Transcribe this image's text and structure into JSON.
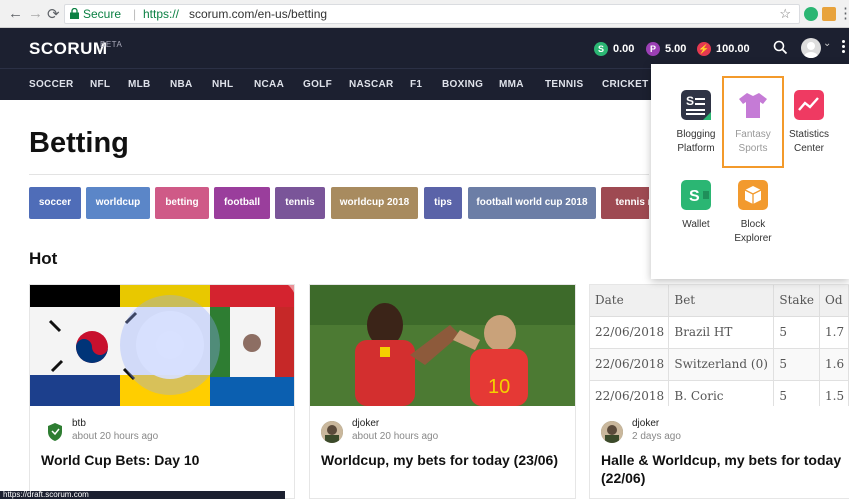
{
  "browser": {
    "secure_label": "Secure",
    "url_scheme": "https://",
    "url_rest": "scorum.com/en-us/betting",
    "status_url": "https://draft.scorum.com"
  },
  "header": {
    "logo": "SCORUM",
    "beta": "BETA",
    "balances": [
      {
        "symbol": "S",
        "value": "0.00",
        "color": "#2bb673"
      },
      {
        "symbol": "P",
        "value": "5.00",
        "color": "#9b3fb5"
      },
      {
        "symbol": "⚡",
        "value": "100.00",
        "color": "#e53950"
      }
    ],
    "sports": [
      "SOCCER",
      "NFL",
      "MLB",
      "NBA",
      "NHL",
      "NCAA",
      "GOLF",
      "NASCAR",
      "F1",
      "BOXING",
      "MMA",
      "TENNIS",
      "CRICKET"
    ]
  },
  "page": {
    "title": "Betting",
    "hot_label": "Hot",
    "tags": [
      {
        "label": "soccer",
        "color": "#4f6db8"
      },
      {
        "label": "worldcup",
        "color": "#5b86c8"
      },
      {
        "label": "betting",
        "color": "#cf5a87"
      },
      {
        "label": "football",
        "color": "#9a3e9c"
      },
      {
        "label": "tennis",
        "color": "#7a5599"
      },
      {
        "label": "worldcup 2018",
        "color": "#a88b5f"
      },
      {
        "label": "tips",
        "color": "#5a63a8"
      },
      {
        "label": "football world cup 2018",
        "color": "#6c7ea6"
      },
      {
        "label": "tennis m",
        "color": "#9e4a52"
      }
    ]
  },
  "cards": [
    {
      "author": "btb",
      "time": "about 20 hours ago",
      "title": "World Cup Bets: Day 10"
    },
    {
      "author": "djoker",
      "time": "about 20 hours ago",
      "title": "Worldcup, my bets for today (23/06)"
    },
    {
      "author": "djoker",
      "time": "2 days ago",
      "title": "Halle & Worldcup, my bets for today (22/06)"
    }
  ],
  "bets_table": {
    "headers": [
      "Date",
      "Bet",
      "Stake",
      "Od"
    ],
    "rows": [
      [
        "22/06/2018",
        "Brazil HT",
        "5",
        "1.7"
      ],
      [
        "22/06/2018",
        "Switzerland (0)",
        "5",
        "1.6"
      ],
      [
        "22/06/2018",
        "B. Coric",
        "5",
        "1.5"
      ]
    ]
  },
  "apps": [
    {
      "label1": "Blogging",
      "label2": "Platform"
    },
    {
      "label1": "Fantasy",
      "label2": "Sports"
    },
    {
      "label1": "Statistics",
      "label2": "Center"
    },
    {
      "label1": "Wallet",
      "label2": ""
    },
    {
      "label1": "Block",
      "label2": "Explorer"
    }
  ]
}
